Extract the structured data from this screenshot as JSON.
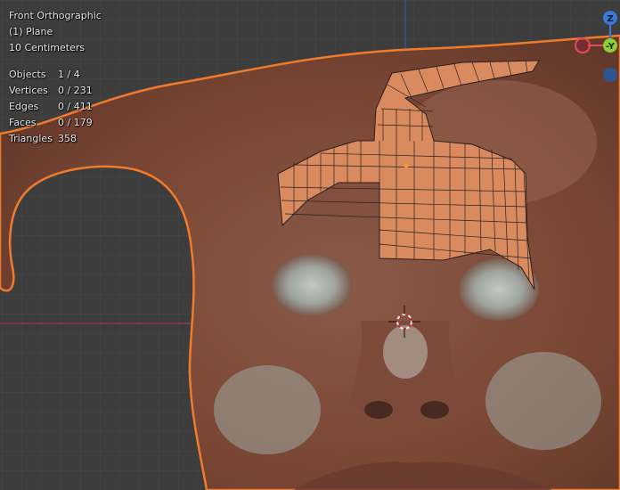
{
  "viewport": {
    "view_name": "Front Orthographic",
    "active_object": "(1) Plane",
    "grid_scale": "10 Centimeters"
  },
  "stats": [
    {
      "label": "Objects",
      "value": "1 / 4"
    },
    {
      "label": "Vertices",
      "value": "0 / 231"
    },
    {
      "label": "Edges",
      "value": "0 / 411"
    },
    {
      "label": "Faces",
      "value": "0 / 179"
    },
    {
      "label": "Triangles",
      "value": "358"
    }
  ],
  "gizmo": {
    "z_label": "Z",
    "y_label": "-Y",
    "colors": {
      "x": "#e8475c",
      "y": "#8ccf34",
      "z": "#3b7ad0"
    }
  },
  "colors": {
    "outline": "#f07b2d",
    "grid_bg": "#3d3d3d",
    "mesh_face": "#d98b5f"
  }
}
